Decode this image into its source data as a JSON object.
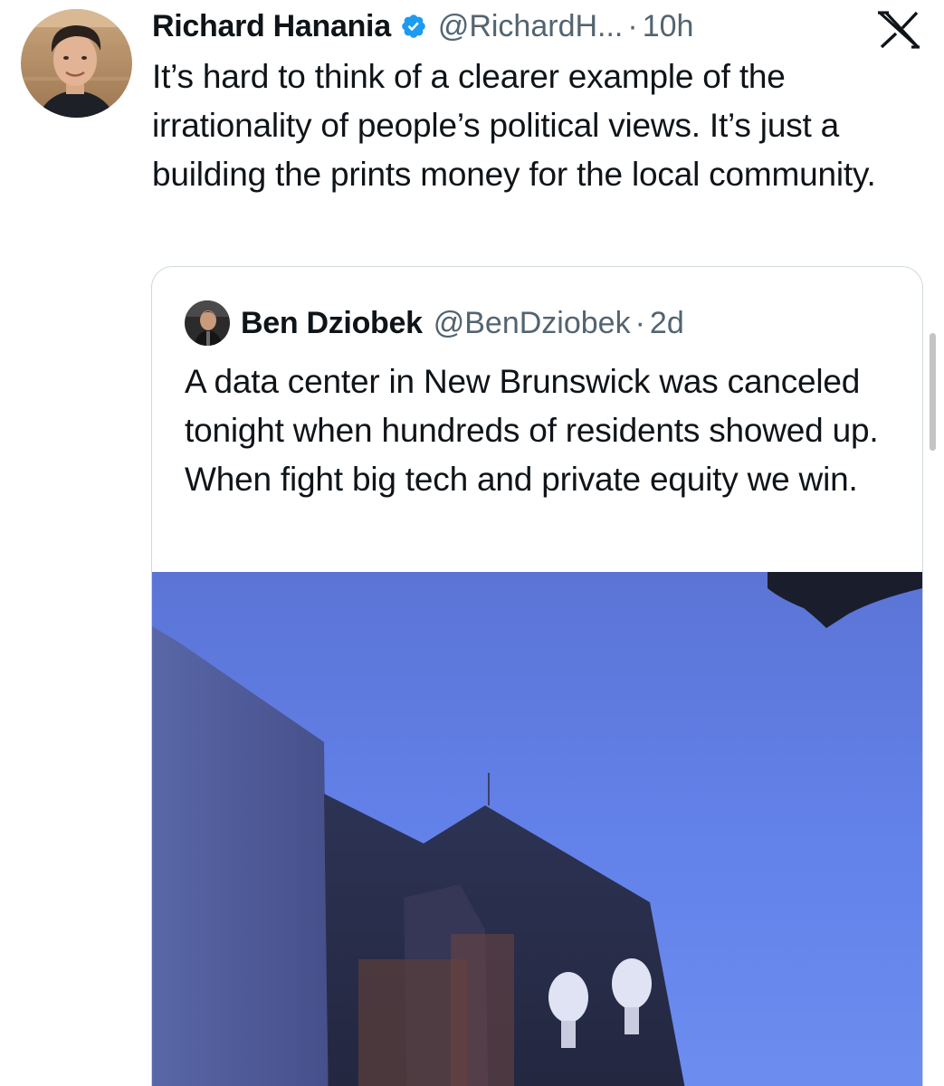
{
  "tweet": {
    "author_name": "Richard Hanania",
    "handle": "@RichardH...",
    "separator": "·",
    "time": "10h",
    "text": "It’s hard to think of a clearer example of the irrationality of people’s political views. It’s just a building the prints money for the local community."
  },
  "quoted_tweet": {
    "author_name": "Ben Dziobek",
    "handle": "@BenDziobek",
    "separator": "·",
    "time": "2d",
    "text": "A data center in New Brunswick was canceled tonight when hundreds of residents showed up. When fight big tech and private equity we win."
  },
  "icons": {
    "verified": "verified-badge-icon",
    "brand": "x-logo-icon"
  },
  "colors": {
    "text_primary": "#0f1419",
    "text_secondary": "#536471",
    "verified_blue": "#1d9bf0",
    "card_border": "#cfd9de",
    "media_sky": "#5d7ee8"
  }
}
